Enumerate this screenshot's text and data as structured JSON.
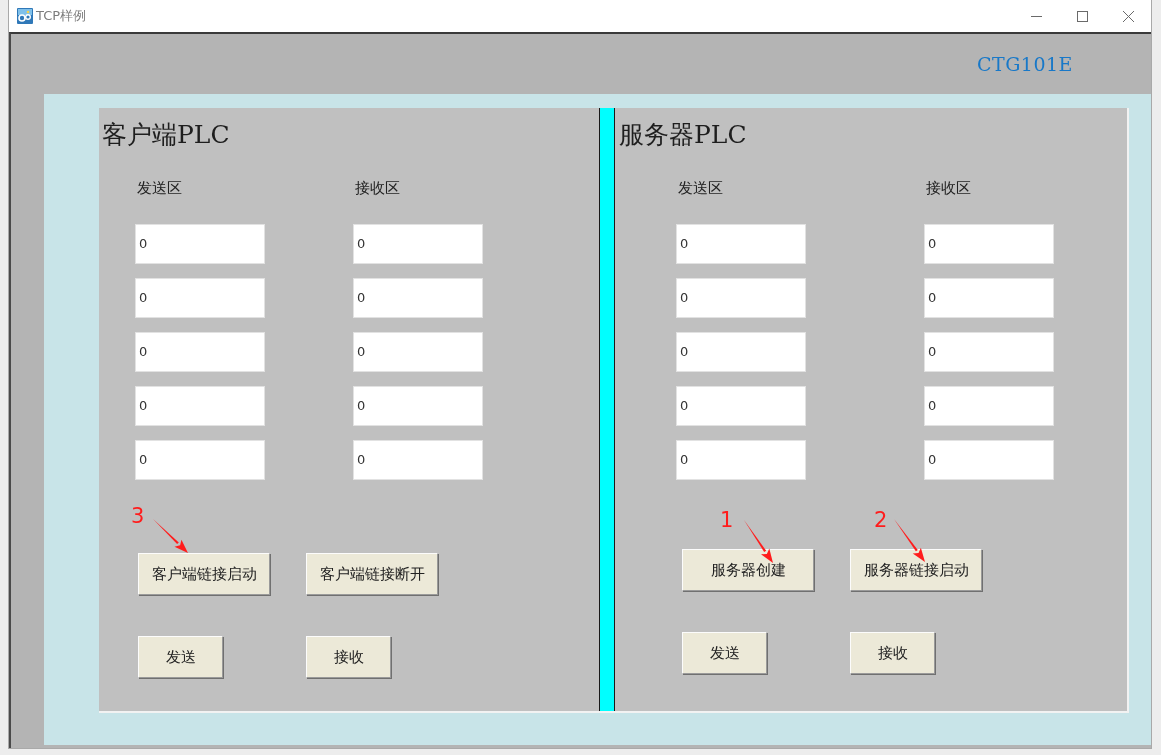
{
  "window": {
    "title": "TCP样例"
  },
  "header": {
    "brand": "CTG101E"
  },
  "panels": [
    {
      "title": "客户端PLC",
      "columns": [
        {
          "label": "发送区",
          "fields": [
            {
              "value": "0"
            },
            {
              "value": "0"
            },
            {
              "value": "0"
            },
            {
              "value": "0"
            },
            {
              "value": "0"
            }
          ]
        },
        {
          "label": "接收区",
          "fields": [
            {
              "value": "0"
            },
            {
              "value": "0"
            },
            {
              "value": "0"
            },
            {
              "value": "0"
            },
            {
              "value": "0"
            }
          ]
        }
      ],
      "buttons": [
        {
          "label": "客户端链接启动",
          "annotation": "3"
        },
        {
          "label": "客户端链接断开"
        },
        {
          "label": "发送"
        },
        {
          "label": "接收"
        }
      ]
    },
    {
      "title": "服务器PLC",
      "columns": [
        {
          "label": "发送区",
          "fields": [
            {
              "value": "0"
            },
            {
              "value": "0"
            },
            {
              "value": "0"
            },
            {
              "value": "0"
            },
            {
              "value": "0"
            }
          ]
        },
        {
          "label": "接收区",
          "fields": [
            {
              "value": "0"
            },
            {
              "value": "0"
            },
            {
              "value": "0"
            },
            {
              "value": "0"
            },
            {
              "value": "0"
            }
          ]
        }
      ],
      "buttons": [
        {
          "label": "服务器创建",
          "annotation": "1"
        },
        {
          "label": "服务器链接启动",
          "annotation": "2"
        },
        {
          "label": "发送"
        },
        {
          "label": "接收"
        }
      ]
    }
  ]
}
